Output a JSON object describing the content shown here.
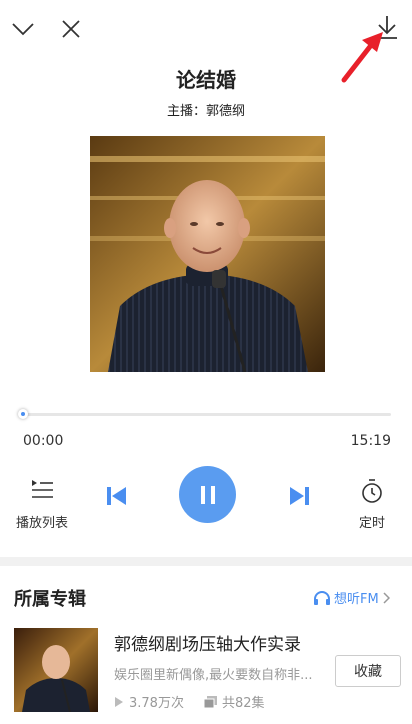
{
  "episode": {
    "title": "论结婚",
    "host_line": "主播：郭德纲"
  },
  "player": {
    "current_time": "00:00",
    "total_time": "15:19",
    "progress": 0.0,
    "state": "playing"
  },
  "controls": {
    "playlist_label": "播放列表",
    "timer_label": "定时"
  },
  "album_section": {
    "heading": "所属专辑",
    "brand": "想听FM",
    "album_title": "郭德纲剧场压轴大作实录",
    "album_desc": "娱乐圈里新偶像,最火要数自称非...",
    "plays": "3.78万次",
    "episodes": "共82集",
    "collect_label": "收藏"
  },
  "colors": {
    "accent": "#5a9cf0",
    "annotation_arrow": "#e8202a"
  },
  "icons": [
    "chevron-down-icon",
    "close-icon",
    "download-icon",
    "annotation-arrow",
    "playlist-icon",
    "prev-icon",
    "pause-icon",
    "next-icon",
    "timer-icon",
    "headphones-icon",
    "chevron-right-icon",
    "play-count-icon",
    "episodes-icon"
  ]
}
